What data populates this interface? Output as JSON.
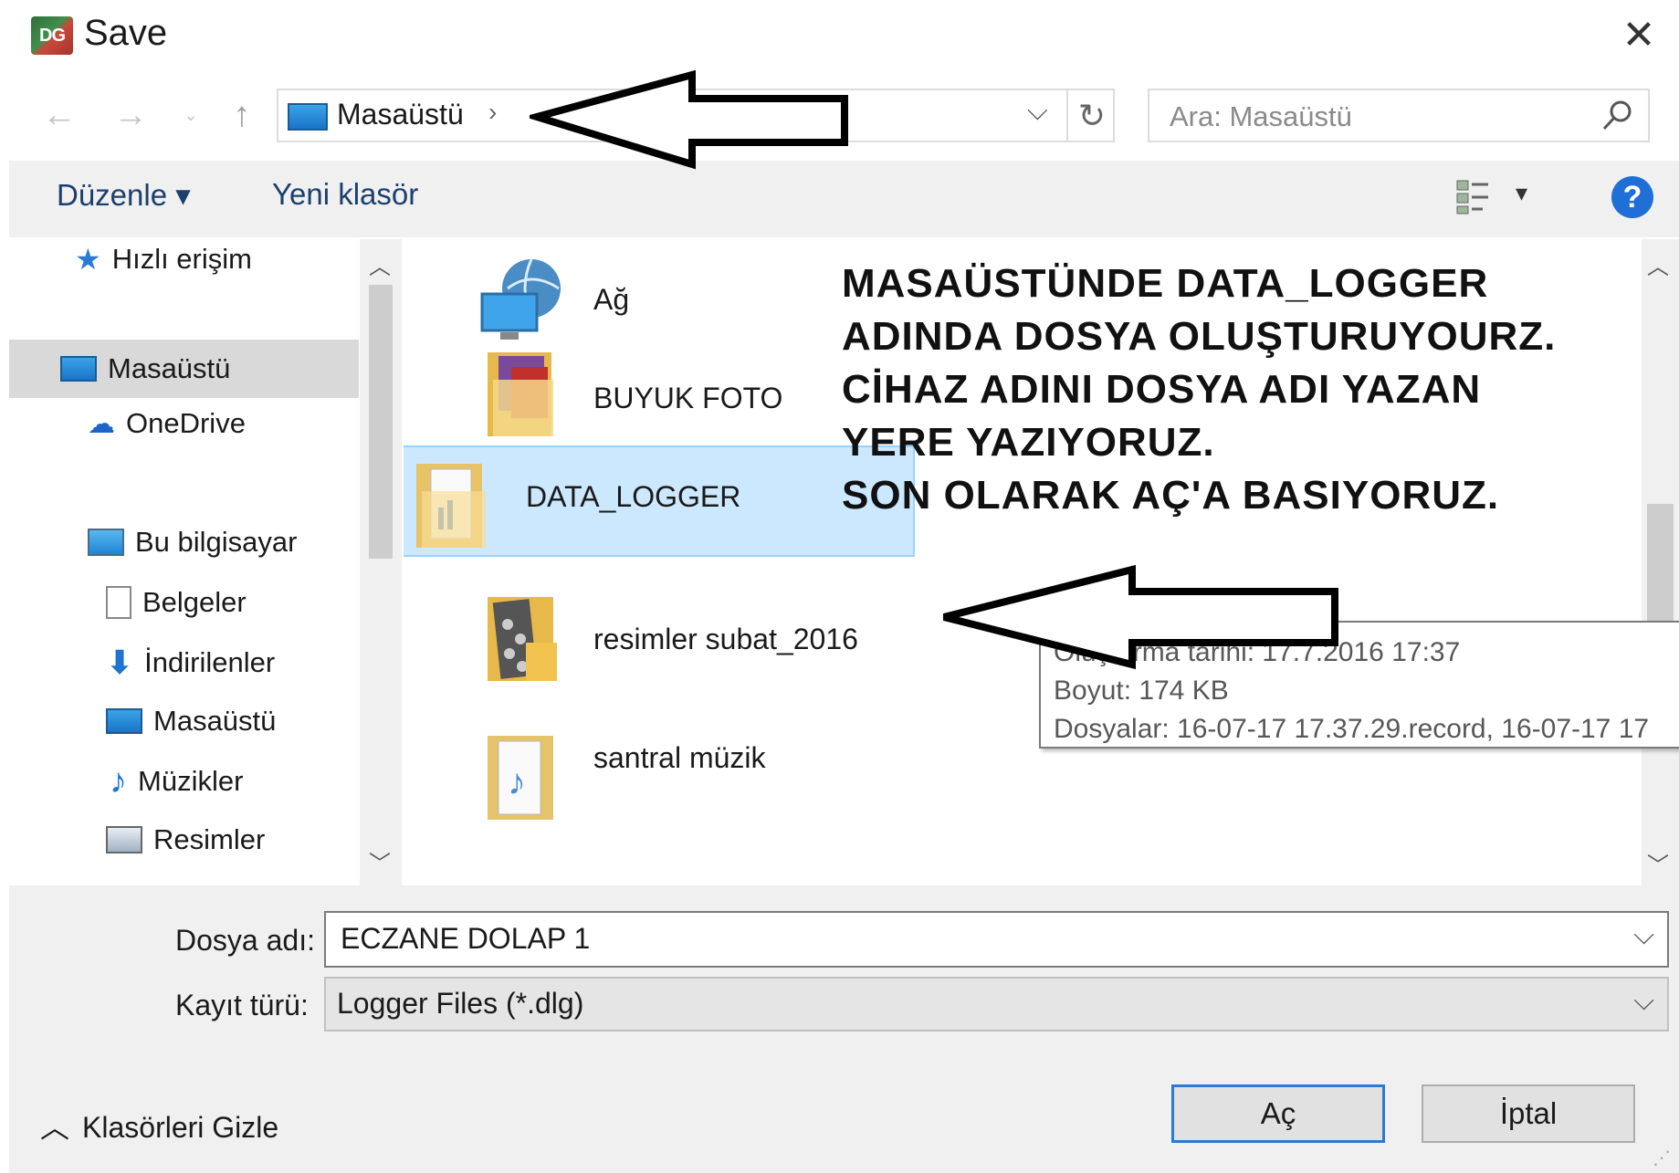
{
  "window": {
    "title": "Save",
    "close": "✕"
  },
  "address": {
    "path": "Masaüstü",
    "chevron": "›",
    "dropdown": "⌵",
    "refresh": "↻"
  },
  "search": {
    "placeholder": "Ara: Masaüstü"
  },
  "toolbar": {
    "organize": "Düzenle ▾",
    "new_folder": "Yeni klasör",
    "view_dropdown": "▾",
    "help": "?"
  },
  "nav": {
    "items": [
      {
        "label": "Hızlı erişim"
      },
      {
        "label": "Masaüstü"
      },
      {
        "label": "OneDrive"
      },
      {
        "label": "Bu bilgisayar"
      },
      {
        "label": "Belgeler"
      },
      {
        "label": "İndirilenler"
      },
      {
        "label": "Masaüstü"
      },
      {
        "label": "Müzikler"
      },
      {
        "label": "Resimler"
      }
    ]
  },
  "files": [
    {
      "name": "Ağ"
    },
    {
      "name": "BUYUK FOTO"
    },
    {
      "name": "DATA_LOGGER"
    },
    {
      "name": "resimler subat_2016"
    },
    {
      "name": "santral müzik"
    }
  ],
  "annotation": {
    "line1": "MASAÜSTÜNDE DATA_LOGGER",
    "line2": "ADINDA DOSYA OLUŞTURUYOURZ.",
    "line3": "CİHAZ ADINI DOSYA ADI YAZAN",
    "line4": "YERE YAZIYORUZ.",
    "line5": "SON OLARAK AÇ'A BASIYORUZ."
  },
  "tooltip": {
    "line1": "Oluşturma tarihi: 17.7.2016 17:37",
    "line2": "Boyut: 174 KB",
    "line3": "Dosyalar: 16-07-17  17.37.29.record, 16-07-17  17"
  },
  "form": {
    "filename_label": "Dosya adı:",
    "filename_value": "ECZANE DOLAP 1",
    "filetype_label": "Kayıt türü:",
    "filetype_value": "Logger Files (*.dlg)"
  },
  "footer": {
    "hide_folders": "Klasörleri Gizle",
    "open": "Aç",
    "cancel": "İptal"
  },
  "colors": {
    "selection": "#cce8ff",
    "accent": "#2b7ad4",
    "help": "#1f6fd6"
  }
}
